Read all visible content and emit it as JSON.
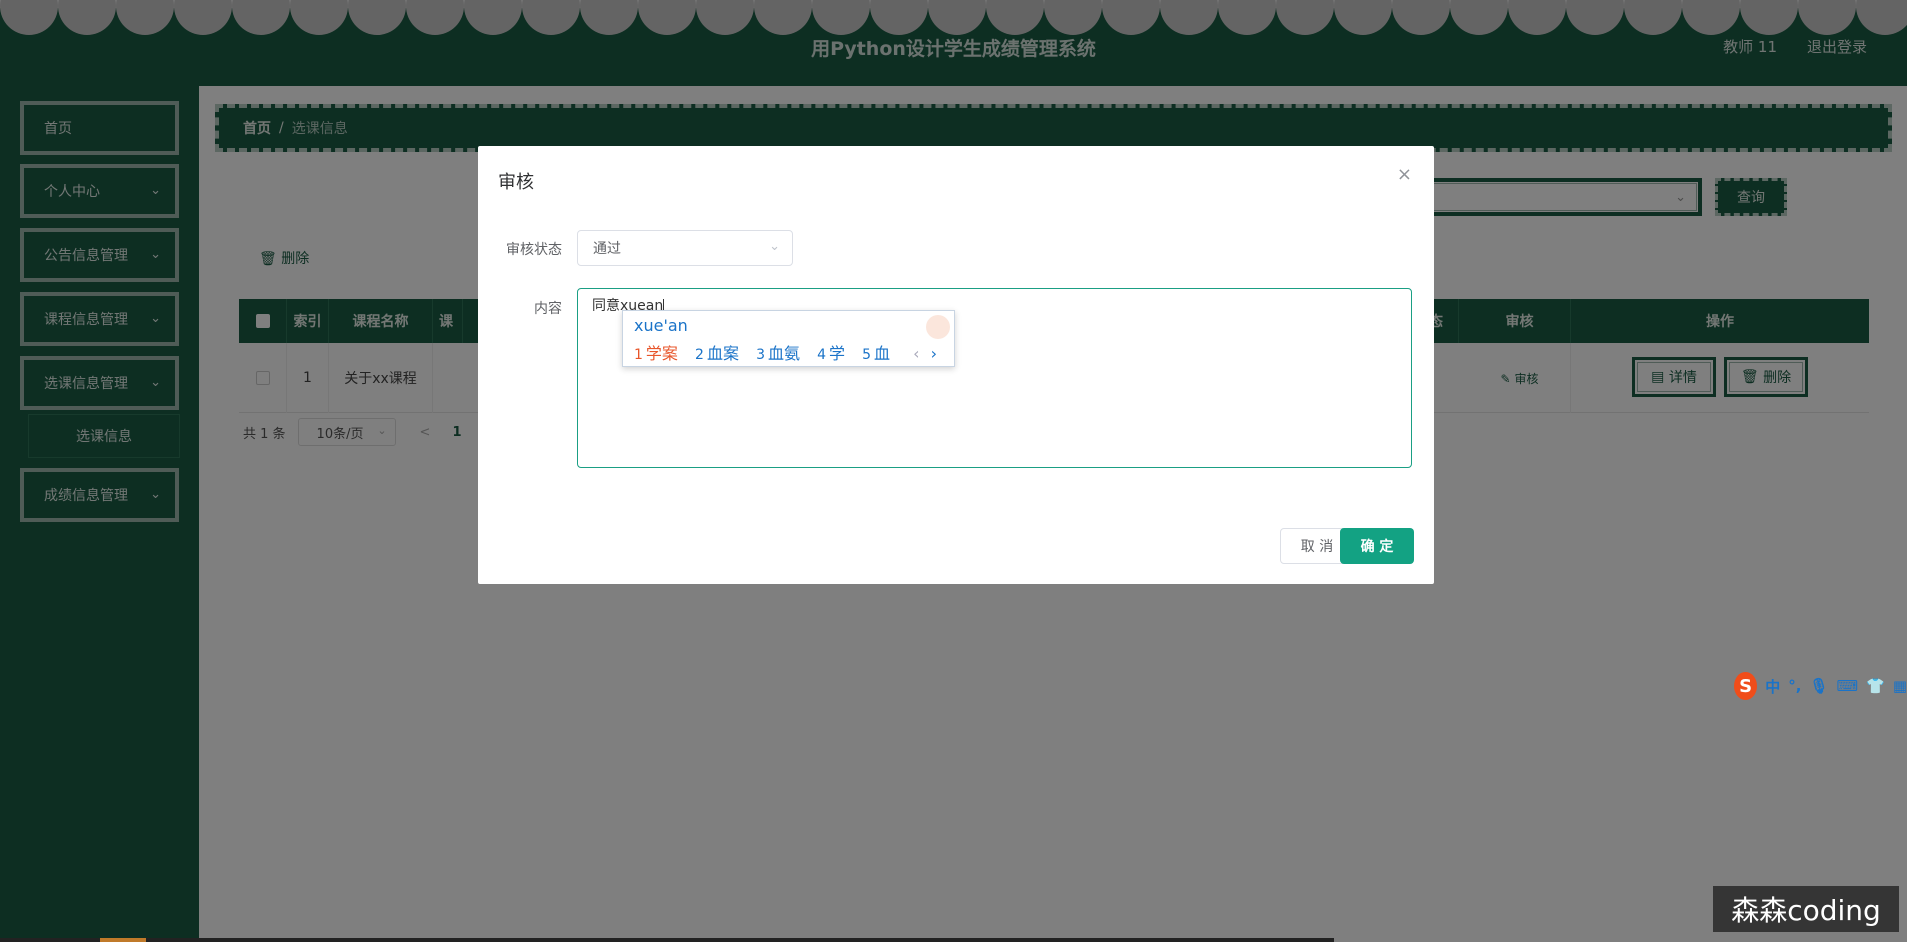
{
  "header": {
    "title": "用Python设计学生成绩管理系统",
    "user": "教师 11",
    "logout": "退出登录"
  },
  "sidebar": {
    "items": [
      {
        "label": "首页"
      },
      {
        "label": "个人中心"
      },
      {
        "label": "公告信息管理"
      },
      {
        "label": "课程信息管理"
      },
      {
        "label": "选课信息管理"
      },
      {
        "label": "成绩信息管理"
      }
    ],
    "submenu": "选课信息"
  },
  "breadcrumb": {
    "home": "首页",
    "separator": "/",
    "current": "选课信息"
  },
  "toolbar": {
    "query": "查询",
    "delete": "删除"
  },
  "table": {
    "columns": [
      "索引",
      "课程名称",
      "课",
      "态",
      "审核",
      "操作"
    ],
    "rows": [
      {
        "index": "1",
        "course": "关于xx课程",
        "audit": "审核",
        "detail": "详情",
        "delete": "删除"
      }
    ]
  },
  "pager": {
    "total": "共 1 条",
    "page_size": "10条/页",
    "prev": "<",
    "page": "1"
  },
  "dialog": {
    "title": "审核",
    "close": "×",
    "status_label": "审核状态",
    "status_value": "通过",
    "content_label": "内容",
    "content_value": "同意xuean",
    "cancel": "取 消",
    "confirm": "确 定"
  },
  "ime": {
    "pinyin": "xue'an",
    "candidates": [
      {
        "n": "1",
        "text": "学案"
      },
      {
        "n": "2",
        "text": "血案"
      },
      {
        "n": "3",
        "text": "血氨"
      },
      {
        "n": "4",
        "text": "学"
      },
      {
        "n": "5",
        "text": "血"
      }
    ],
    "prev": "‹",
    "next": "›",
    "toolbar_logo": "S",
    "toolbar_mode": "中"
  },
  "watermark": "森森coding",
  "colors": {
    "primary": "#1a5c44",
    "accent": "#13a283",
    "highlight": "#e8552a"
  }
}
